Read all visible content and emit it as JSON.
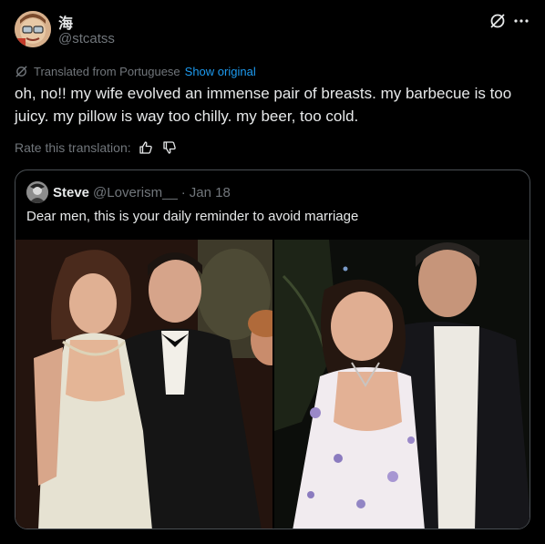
{
  "author": {
    "display_name": "海",
    "handle": "@stcatss"
  },
  "translation": {
    "label": "Translated from Portuguese",
    "show_original": "Show original"
  },
  "tweet": {
    "text": "oh, no!! my wife evolved an immense pair of breasts. my barbecue is too juicy. my pillow is way too chilly. my beer, too cold."
  },
  "rate": {
    "label": "Rate this translation:"
  },
  "quote": {
    "name": "Steve",
    "handle": "@Loverism__",
    "separator": "·",
    "date": "Jan 18",
    "text": "Dear men, this is your daily reminder to avoid marriage"
  },
  "icons": [
    "avatar",
    "grok-icon",
    "more-icon",
    "translate-icon",
    "thumbs-up-icon",
    "thumbs-down-icon"
  ],
  "colors": {
    "background": "#000000",
    "text": "#e7e9ea",
    "muted": "#71767b",
    "link": "#1d9bf0",
    "border": "#4a4f54"
  }
}
